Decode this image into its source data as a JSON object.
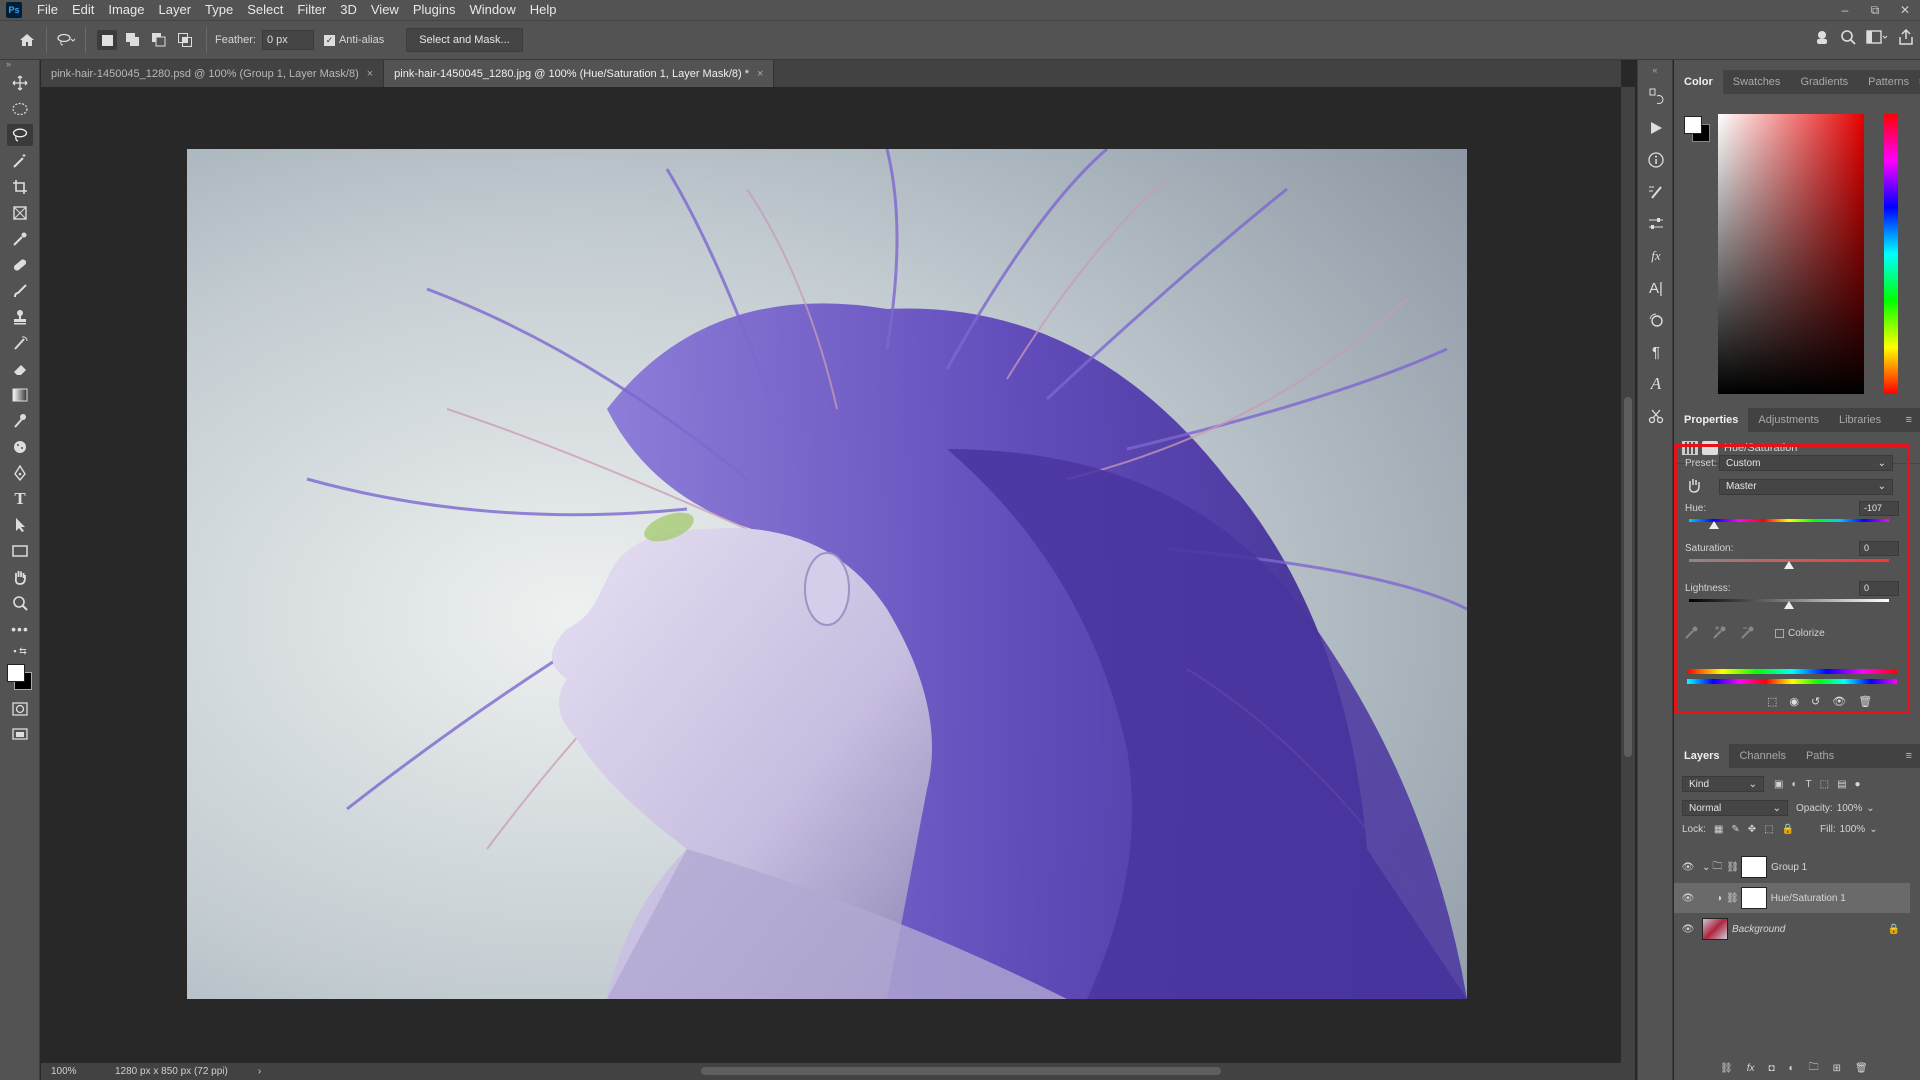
{
  "menubar": {
    "logo": "Ps",
    "items": [
      "File",
      "Edit",
      "Image",
      "Layer",
      "Type",
      "Select",
      "Filter",
      "3D",
      "View",
      "Plugins",
      "Window",
      "Help"
    ]
  },
  "options": {
    "feather_label": "Feather:",
    "feather_value": "0 px",
    "antialias_label": "Anti-alias",
    "select_mask_label": "Select and Mask..."
  },
  "tabs": [
    {
      "title": "pink-hair-1450045_1280.psd @ 100% (Group 1, Layer Mask/8)",
      "active": false
    },
    {
      "title": "pink-hair-1450045_1280.jpg @ 100% (Hue/Saturation 1, Layer Mask/8) *",
      "active": true
    }
  ],
  "status": {
    "zoom": "100%",
    "doc_size": "1280 px x 850 px (72 ppi)"
  },
  "color_panel": {
    "tabs": [
      "Color",
      "Swatches",
      "Gradients",
      "Patterns"
    ],
    "foreground": "#ffffff",
    "background": "#000000"
  },
  "properties_panel": {
    "tabs": [
      "Properties",
      "Adjustments",
      "Libraries"
    ],
    "adjustment_name": "Hue/Saturation",
    "preset_label": "Preset:",
    "preset_value": "Custom",
    "channel_value": "Master",
    "hue_label": "Hue:",
    "hue_value": "-107",
    "saturation_label": "Saturation:",
    "saturation_value": "0",
    "lightness_label": "Lightness:",
    "lightness_value": "0",
    "colorize_label": "Colorize"
  },
  "layers_panel": {
    "tabs": [
      "Layers",
      "Channels",
      "Paths"
    ],
    "kind_label": "Kind",
    "blend_mode": "Normal",
    "opacity_label": "Opacity:",
    "opacity_value": "100%",
    "lock_label": "Lock:",
    "fill_label": "Fill:",
    "fill_value": "100%",
    "layers": [
      {
        "name": "Group 1"
      },
      {
        "name": "Hue/Saturation 1"
      },
      {
        "name": "Background"
      }
    ]
  },
  "colors": {
    "highlight_border": "#e8101a",
    "hair": "#6b55c8"
  }
}
